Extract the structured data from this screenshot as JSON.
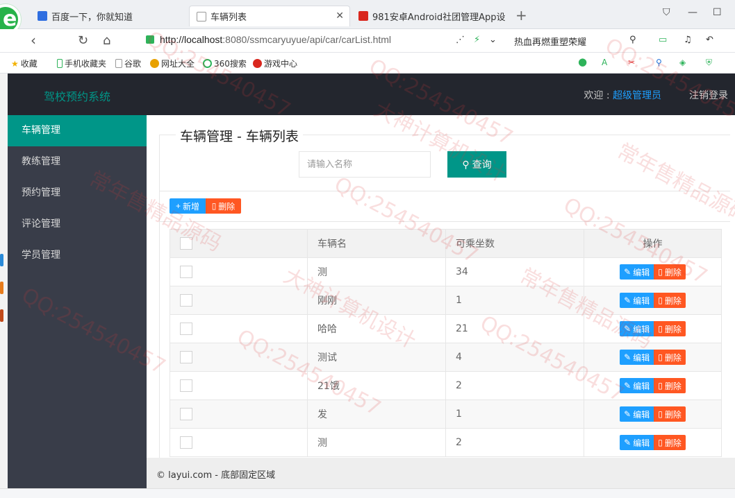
{
  "browser": {
    "tabs": [
      {
        "title": "百度一下，你就知道"
      },
      {
        "title": "车辆列表"
      },
      {
        "title": "981安卓Android社团管理App设"
      }
    ],
    "url_host": "http://localhost",
    "url_rest": ":8080/ssmcaryuyue/api/car/carList.html",
    "search_hint": "热血再燃重塑荣耀",
    "bookmarks": [
      "收藏",
      "手机收藏夹",
      "谷歌",
      "网址大全",
      "360搜索",
      "游戏中心"
    ]
  },
  "header": {
    "logo": "驾校预约系统",
    "welcome_prefix": "欢迎 : ",
    "admin_name": "超级管理员",
    "logout": "注销登录"
  },
  "sidebar": {
    "items": [
      {
        "label": "车辆管理",
        "active": true
      },
      {
        "label": "教练管理",
        "active": false
      },
      {
        "label": "预约管理",
        "active": false
      },
      {
        "label": "评论管理",
        "active": false
      },
      {
        "label": "学员管理",
        "active": false
      }
    ]
  },
  "main": {
    "title": "车辆管理 - 车辆列表",
    "search_placeholder": "请输入名称",
    "search_button": "查询",
    "add_button": "新增",
    "delete_button": "删除",
    "columns": {
      "name": "车辆名",
      "seats": "可乘坐数",
      "ops": "操作"
    },
    "row_edit": "编辑",
    "row_delete": "删除",
    "rows": [
      {
        "name": "测",
        "seats": "34"
      },
      {
        "name": "刚刚",
        "seats": "1"
      },
      {
        "name": "哈哈",
        "seats": "21"
      },
      {
        "name": "测试",
        "seats": "4"
      },
      {
        "name": "21饿",
        "seats": "2"
      },
      {
        "name": "发",
        "seats": "1"
      },
      {
        "name": "测",
        "seats": "2"
      }
    ]
  },
  "footer": {
    "text": "© layui.com - 底部固定区域"
  },
  "watermark": {
    "qq": "QQ:254540457",
    "shop": "常年售精品源码",
    "design": "大神计算机设计"
  },
  "colors": {
    "accent": "#009688",
    "header_bg": "#23262e",
    "nav_bg": "#393d49",
    "blue": "#1e9fff",
    "red": "#ff5722"
  }
}
